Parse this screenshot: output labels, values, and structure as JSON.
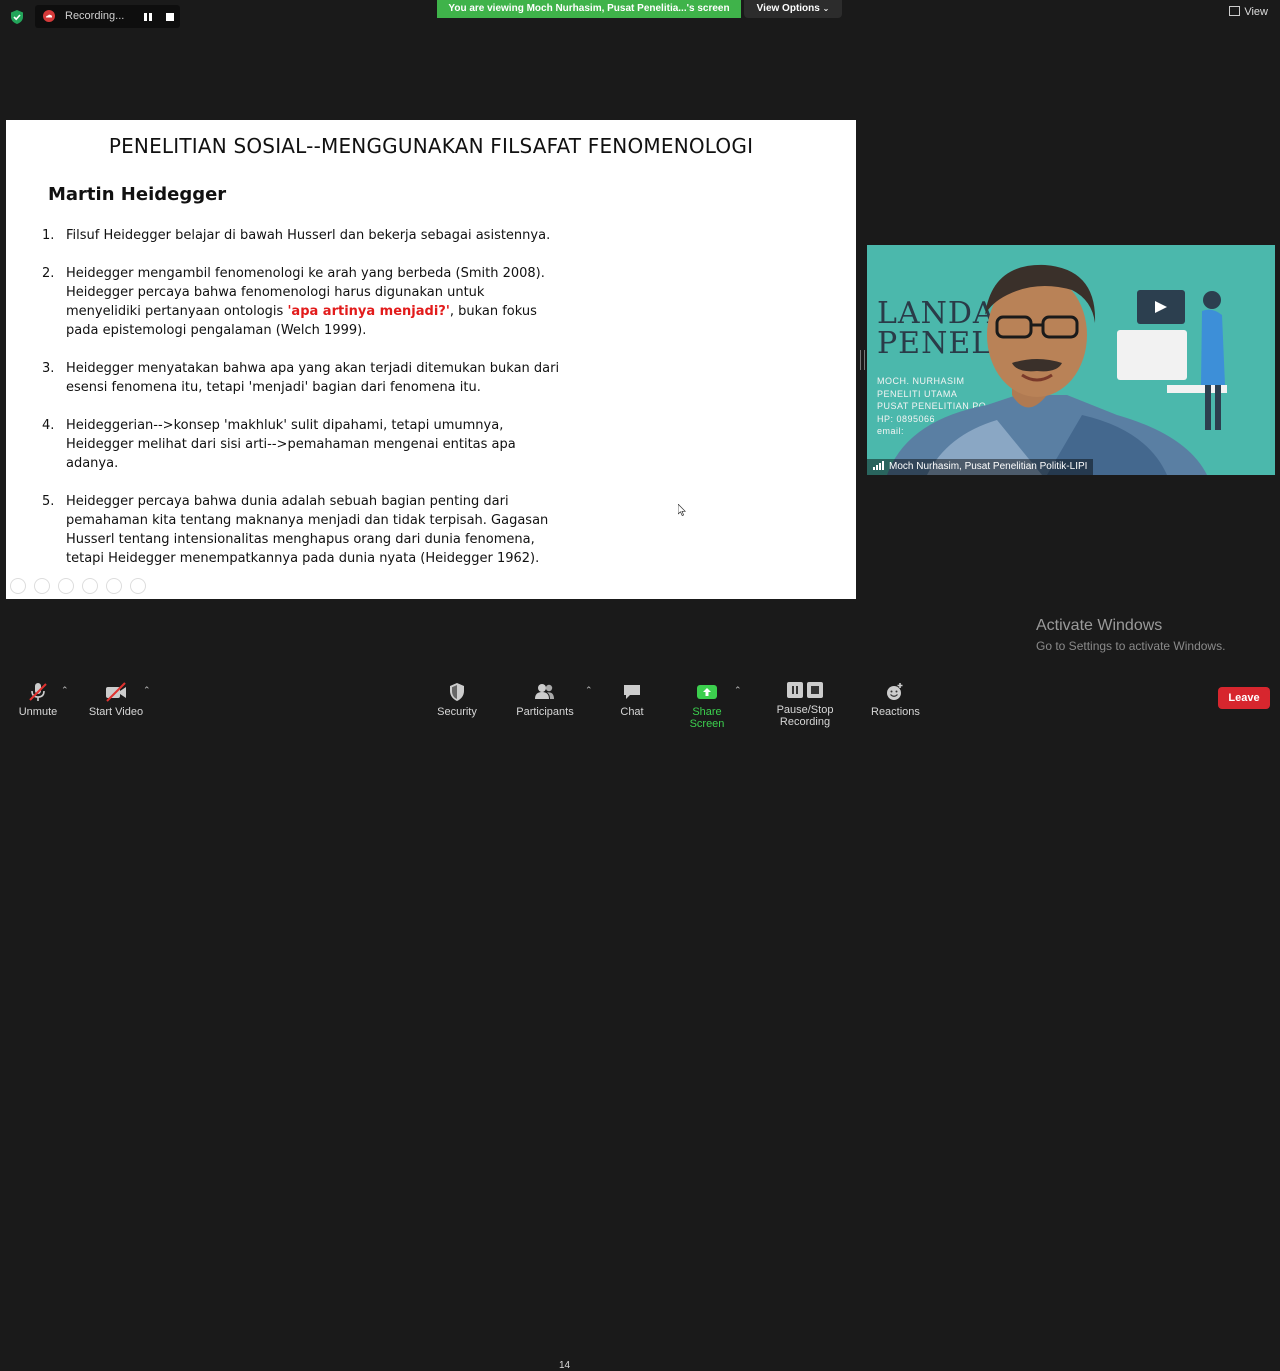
{
  "top": {
    "recording_label": "Recording...",
    "share_banner": "You are viewing Moch Nurhasim, Pusat Penelitia...'s screen",
    "view_options": "View Options",
    "view_label": "View"
  },
  "slide": {
    "title": "PENELITIAN SOSIAL--MENGGUNAKAN FILSAFAT FENOMENOLOGI",
    "subtitle": "Martin Heidegger",
    "points": [
      {
        "num": "1.",
        "text": "Filsuf Heidegger belajar di bawah Husserl dan bekerja sebagai asistennya."
      },
      {
        "num": "2.",
        "pre": "Heidegger mengambil fenomenologi ke arah yang berbeda (Smith 2008). Heidegger percaya bahwa fenomenologi harus digunakan untuk menyelidiki pertanyaan ontologis ",
        "highlight": "'apa artinya menjadi?'",
        "post": ", bukan fokus pada epistemologi pengalaman (Welch 1999)."
      },
      {
        "num": "3.",
        "text": "Heidegger menyatakan bahwa apa yang akan terjadi ditemukan bukan dari esensi fenomena itu, tetapi 'menjadi' bagian dari fenomena itu."
      },
      {
        "num": "4.",
        "text": "Heideggerian-->konsep 'makhluk' sulit dipahami, tetapi umumnya, Heidegger melihat dari sisi arti-->pemahaman mengenai entitas apa adanya."
      },
      {
        "num": "5.",
        "text": "Heidegger percaya bahwa dunia adalah sebuah bagian penting dari pemahaman kita tentang maknanya menjadi dan tidak terpisah. Gagasan Husserl tentang intensionalitas menghapus orang dari dunia fenomena, tetapi Heidegger menempatkannya pada dunia nyata (Heidegger 1962)."
      }
    ]
  },
  "video": {
    "bg_title_line1": "LANDA",
    "bg_title_line2": "PENEL",
    "bg_small_lines": [
      "MOCH. NURHASIM",
      "PENELITI UTAMA",
      "PUSAT PENELITIAN PO",
      "HP: 0895066",
      "email:"
    ],
    "participant_name": "Moch Nurhasim, Pusat Penelitian Politik-LIPI"
  },
  "watermark": {
    "title": "Activate Windows",
    "subtitle": "Go to Settings to activate Windows."
  },
  "toolbar": {
    "unmute": "Unmute",
    "start_video": "Start Video",
    "security": "Security",
    "participants": "Participants",
    "participants_count": "14",
    "chat": "Chat",
    "share_screen": "Share Screen",
    "pause_stop_recording": "Pause/Stop Recording",
    "reactions": "Reactions",
    "leave": "Leave"
  },
  "colors": {
    "share_green": "#3fb34a",
    "leave_red": "#d7262e",
    "highlight_red": "#e21b1b",
    "video_bg": "#4bb8ac"
  }
}
